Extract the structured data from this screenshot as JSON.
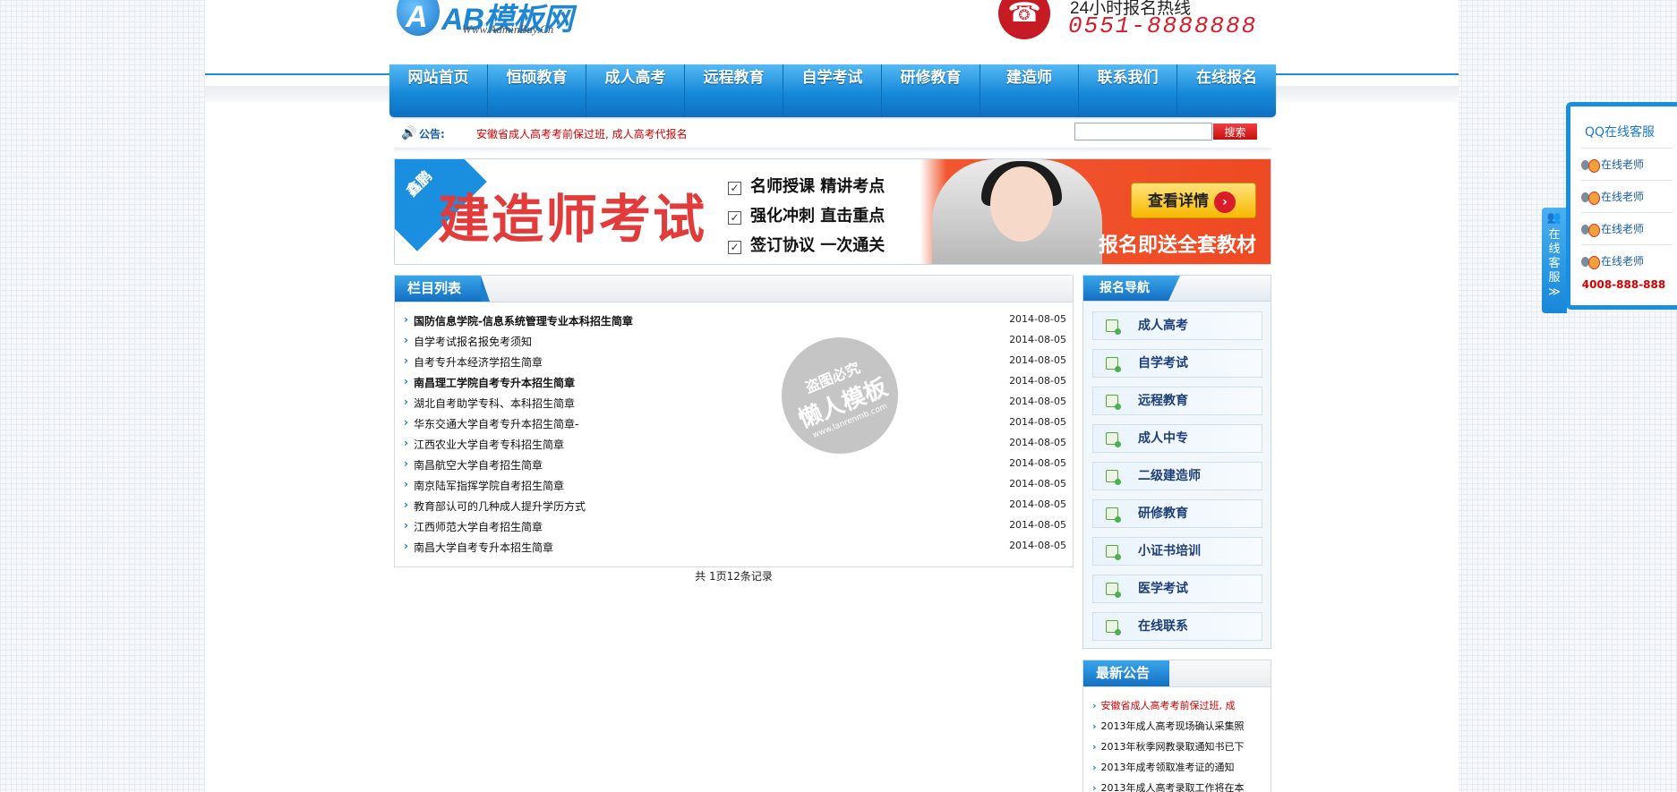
{
  "header": {
    "logo_mark": "A",
    "logo_text": "AB模板网",
    "logo_sub": "Www.AdminBuy.Cn",
    "hotline_label": "24小时报名热线",
    "hotline_number": "0551-8888888"
  },
  "nav": [
    "网站首页",
    "恒硕教育",
    "成人高考",
    "远程教育",
    "自学考试",
    "研修教育",
    "建造师",
    "联系我们",
    "在线报名"
  ],
  "notice": {
    "label": "公告:",
    "text": "安徽省成人高考考前保过班, 成人高考代报名",
    "search_placeholder": "",
    "search_button": "搜索"
  },
  "banner": {
    "corner": "鑫鹏",
    "title": "建造师考试",
    "points": [
      "名师授课  精讲考点",
      "强化冲刺  直击重点",
      "签订协议  一次通关"
    ],
    "button": "查看详情",
    "gift": "报名即送全套教材"
  },
  "main": {
    "title": "栏目列表",
    "articles": [
      {
        "title": "国防信息学院-信息系统管理专业本科招生简章",
        "date": "2014-08-05",
        "bold": true
      },
      {
        "title": "自学考试报名报免考须知",
        "date": "2014-08-05"
      },
      {
        "title": "自考专升本经济学招生简章",
        "date": "2014-08-05"
      },
      {
        "title": "南昌理工学院自考专升本招生简章",
        "date": "2014-08-05",
        "bold": true
      },
      {
        "title": "湖北自考助学专科、本科招生简章",
        "date": "2014-08-05"
      },
      {
        "title": "华东交通大学自考专升本招生简章-",
        "date": "2014-08-05"
      },
      {
        "title": "江西农业大学自考专科招生简章",
        "date": "2014-08-05"
      },
      {
        "title": "南昌航空大学自考招生简章",
        "date": "2014-08-05"
      },
      {
        "title": "南京陆军指挥学院自考招生简章",
        "date": "2014-08-05"
      },
      {
        "title": "教育部认可的几种成人提升学历方式",
        "date": "2014-08-05"
      },
      {
        "title": "江西师范大学自考招生简章",
        "date": "2014-08-05"
      },
      {
        "title": "南昌大学自考专升本招生简章",
        "date": "2014-08-05"
      }
    ],
    "pagination": "共 1页12条记录"
  },
  "watermark": {
    "line1": "盗图必究",
    "line2": "懒人模板",
    "line3": "www.lanrenmb.com"
  },
  "sidebar": {
    "guide_title": "报名导航",
    "guide_items": [
      "成人高考",
      "自学考试",
      "远程教育",
      "成人中专",
      "二级建造师",
      "研修教育",
      "小证书培训",
      "医学考试",
      "在线联系"
    ],
    "ann_title": "最新公告",
    "announcements": [
      {
        "text": "安徽省成人高考考前保过班, 成",
        "red": true
      },
      {
        "text": "2013年成人高考现场确认采集照"
      },
      {
        "text": "2013年秋季网教录取通知书已下"
      },
      {
        "text": "2013年成考领取准考证的通知"
      },
      {
        "text": "2013年成人高考录取工作将在本"
      }
    ]
  },
  "qq": {
    "tab_text": "在线客服≫",
    "title": "QQ在线客服",
    "items": [
      "在线老师",
      "在线老师",
      "在线老师",
      "在线老师"
    ],
    "phone": "4008-888-888"
  }
}
